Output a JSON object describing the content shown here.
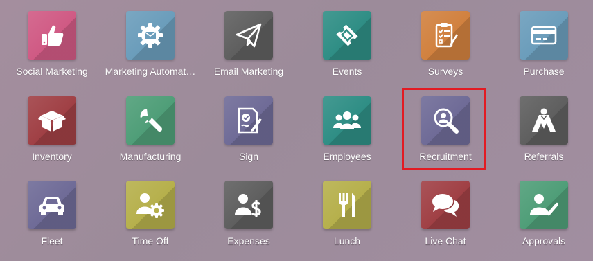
{
  "apps": [
    {
      "label": "Social Marketing",
      "color": "#d05a84",
      "icon": "thumbs-up-icon"
    },
    {
      "label": "Marketing Automat…",
      "color": "#6b9dbb",
      "icon": "gear-mail-icon"
    },
    {
      "label": "Email Marketing",
      "color": "#5f5f5f",
      "icon": "paper-plane-icon"
    },
    {
      "label": "Events",
      "color": "#2f8e85",
      "icon": "ticket-icon"
    },
    {
      "label": "Surveys",
      "color": "#d1813f",
      "icon": "clipboard-check-icon"
    },
    {
      "label": "Purchase",
      "color": "#6b9dbb",
      "icon": "credit-card-icon"
    },
    {
      "label": "Inventory",
      "color": "#a04045",
      "icon": "box-icon"
    },
    {
      "label": "Manufacturing",
      "color": "#4f9e78",
      "icon": "wrench-icon"
    },
    {
      "label": "Sign",
      "color": "#6f6b97",
      "icon": "signed-document-icon"
    },
    {
      "label": "Employees",
      "color": "#2f8e85",
      "icon": "users-icon"
    },
    {
      "label": "Recruitment",
      "color": "#6f6b97",
      "icon": "magnifier-user-icon"
    },
    {
      "label": "Referrals",
      "color": "#5f5f5f",
      "icon": "hero-cape-icon"
    },
    {
      "label": "Fleet",
      "color": "#6f6b97",
      "icon": "car-icon"
    },
    {
      "label": "Time Off",
      "color": "#b6b04c",
      "icon": "user-gear-icon"
    },
    {
      "label": "Expenses",
      "color": "#5f5f5f",
      "icon": "user-dollar-icon"
    },
    {
      "label": "Lunch",
      "color": "#b6b04c",
      "icon": "fork-knife-icon"
    },
    {
      "label": "Live Chat",
      "color": "#a04045",
      "icon": "chat-bubbles-icon"
    },
    {
      "label": "Approvals",
      "color": "#4f9e78",
      "icon": "user-check-icon"
    }
  ],
  "highlight_color": "#e21b23"
}
